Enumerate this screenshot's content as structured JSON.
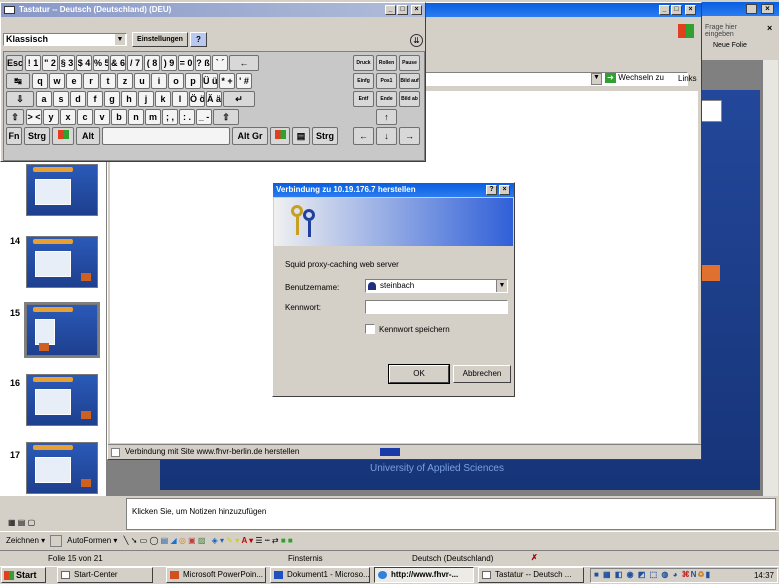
{
  "keyboard": {
    "title": "Tastatur -- Deutsch (Deutschland) (DEU)",
    "layout": "Klassisch",
    "settings": "Einstellungen",
    "row1": [
      "Esc",
      "! 1",
      "\" 2",
      "§ 3",
      "$ 4",
      "% 5",
      "& 6",
      "/ 7",
      "( 8",
      ") 9",
      "= 0",
      "? ß",
      "` ´",
      "←"
    ],
    "row2": [
      "↹",
      "q",
      "w",
      "e",
      "r",
      "t",
      "z",
      "u",
      "i",
      "o",
      "p",
      "Ü ü",
      "* +",
      "' #"
    ],
    "row3": [
      "⇩",
      "a",
      "s",
      "d",
      "f",
      "g",
      "h",
      "j",
      "k",
      "l",
      "Ö ö",
      "Ä ä",
      "↵"
    ],
    "row4": [
      "⇧",
      "> <",
      "y",
      "x",
      "c",
      "v",
      "b",
      "n",
      "m",
      "; ,",
      ": .",
      "_ -",
      "⇧"
    ],
    "row5": [
      "Fn",
      "Strg",
      "",
      "Alt",
      "",
      "Alt Gr",
      "",
      "",
      "Strg"
    ],
    "nav": {
      "druck": "Druck",
      "rollen": "Rollen",
      "pause": "Pause",
      "einfg": "Einfg",
      "pos1": "Pos1",
      "bild_auf": "Bild auf",
      "entf": "Entf",
      "ende": "Ende",
      "bild_ab": "Bild ab"
    }
  },
  "ppt": {
    "help_placeholder": "Frage hier eingeben",
    "new_slide": "Neue Folie",
    "notes": "Klicken Sie, um Notizen hinzuzufügen",
    "draw": "Zeichnen",
    "autoshapes": "AutoFormen",
    "status_slide": "Folie 15 von 21",
    "status_design": "Finsternis",
    "status_lang": "Deutsch (Deutschland)",
    "slide_footer": "University of Applied Sciences",
    "thumbs": [
      "14",
      "15",
      "16",
      "17"
    ]
  },
  "ie": {
    "go": "Wechseln zu",
    "links": "Links",
    "status": "Verbindung mit Site www.fhvr-berlin.de herstellen"
  },
  "dialog": {
    "title": "Verbindung zu 10.19.176.7 herstellen",
    "help": "?",
    "realm": "Squid proxy-caching web server",
    "user_label": "Benutzername:",
    "user_value": "steinbach",
    "pass_label": "Kennwort:",
    "remember": "Kennwort speichern",
    "ok": "OK",
    "cancel": "Abbrechen"
  },
  "taskbar": {
    "start": "Start",
    "items": [
      "Start-Center",
      "Microsoft PowerPoin...",
      "Dokument1 - Microso...",
      "http://www.fhvr-...",
      "Tastatur -- Deutsch ..."
    ],
    "clock": "14:37"
  }
}
